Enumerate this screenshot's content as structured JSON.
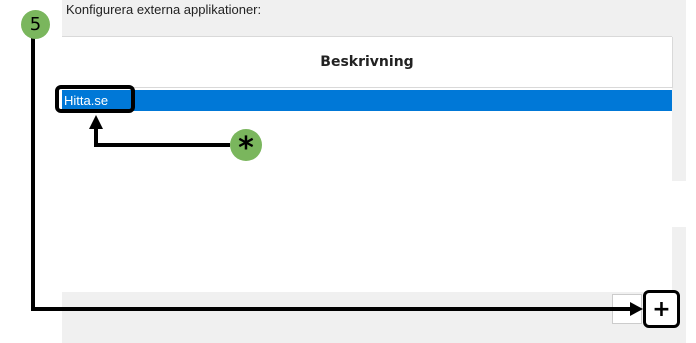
{
  "dialog": {
    "heading": "Konfigurera externa applikationer:",
    "table": {
      "column_header": "Beskrivning",
      "rows": [
        "Hitta.se"
      ],
      "selected_index": 0
    },
    "add_button_label": "+"
  },
  "annotations": {
    "step_number": "5",
    "marker_symbol": "*"
  },
  "colors": {
    "selection": "#0078d7",
    "badge": "#7ab65d",
    "panel": "#f0f0f0"
  }
}
